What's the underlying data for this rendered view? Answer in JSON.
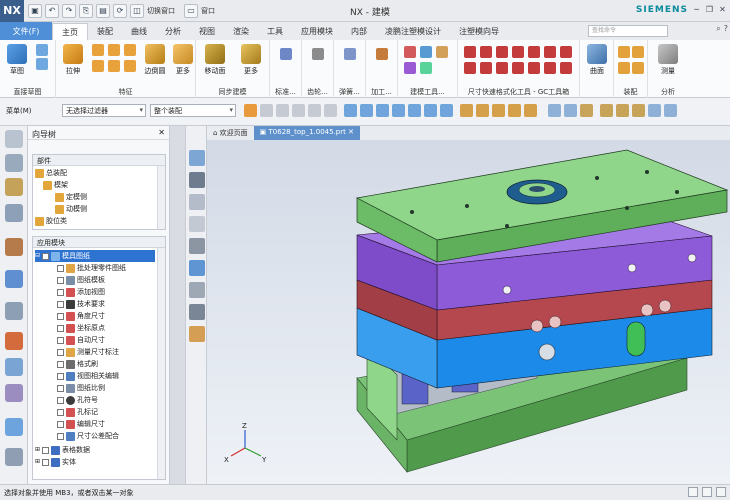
{
  "app": {
    "logo": "NX",
    "title": "NX - 建模",
    "brand": "SIEMENS",
    "quick_switch_window": "切换窗口",
    "quick_window": "窗口"
  },
  "tabs": {
    "file": "文件(F)",
    "items": [
      "主页",
      "装配",
      "曲线",
      "分析",
      "视图",
      "渲染",
      "工具",
      "应用模块",
      "内部",
      "凌鹏注塑模设计",
      "注塑模向导"
    ],
    "active_index": 0
  },
  "search": {
    "placeholder": "查找命令"
  },
  "ribbon": {
    "groups": [
      {
        "label": "直接草图",
        "items": [
          "草图"
        ]
      },
      {
        "label": "特征",
        "items": [
          "拉伸",
          "边倒圆",
          "更多"
        ]
      },
      {
        "label": "同步建模",
        "items": [
          "移动面",
          "更多"
        ]
      },
      {
        "label": "标准...",
        "items": []
      },
      {
        "label": "齿轮...",
        "items": []
      },
      {
        "label": "弹簧...",
        "items": []
      },
      {
        "label": "加工...",
        "items": []
      },
      {
        "label": "建模工具...",
        "items": []
      },
      {
        "label": "尺寸快速格式化工具 - GC工具箱",
        "items": []
      },
      {
        "label": "曲面",
        "items": [
          "曲面"
        ]
      },
      {
        "label": "装配",
        "items": []
      },
      {
        "label": "分析",
        "items": [
          "测量"
        ]
      }
    ]
  },
  "selection_bar": {
    "menu": "菜单(M)",
    "filter": "无选择过滤器",
    "scope": "整个装配"
  },
  "navigator": {
    "title": "向导树",
    "parts_panel": {
      "header": "部件",
      "items": [
        "总装配",
        "模架",
        "定模侧",
        "动模侧",
        "胶位类"
      ]
    },
    "apps_panel": {
      "header": "应用模块",
      "items": [
        "模具图纸",
        "批处理零件图纸",
        "图纸模板",
        "添加视图",
        "技术要求",
        "角度尺寸",
        "坐标原点",
        "自动尺寸",
        "测量尺寸标注",
        "格式刷",
        "视图相关编辑",
        "图纸比例",
        "孔符号",
        "孔标记",
        "编辑尺寸",
        "尺寸公差配合",
        "表格数据",
        "实体"
      ],
      "selected_index": 0
    }
  },
  "document_tabs": [
    "欢迎页面",
    "T0628_top_1.0045.prt"
  ],
  "active_document_index": 1,
  "status": "选择对象并使用 MB3，或者双击某一对象",
  "triad": {
    "x": "X",
    "y": "Y",
    "z": "Z"
  },
  "colors": {
    "plate_green": "#8fd58a",
    "plate_purple": "#8e5bd8",
    "plate_red": "#b5474f",
    "plate_blue": "#1c8ae8",
    "selection_blue": "#2f73d1",
    "file_tab": "#4f8fd8"
  }
}
